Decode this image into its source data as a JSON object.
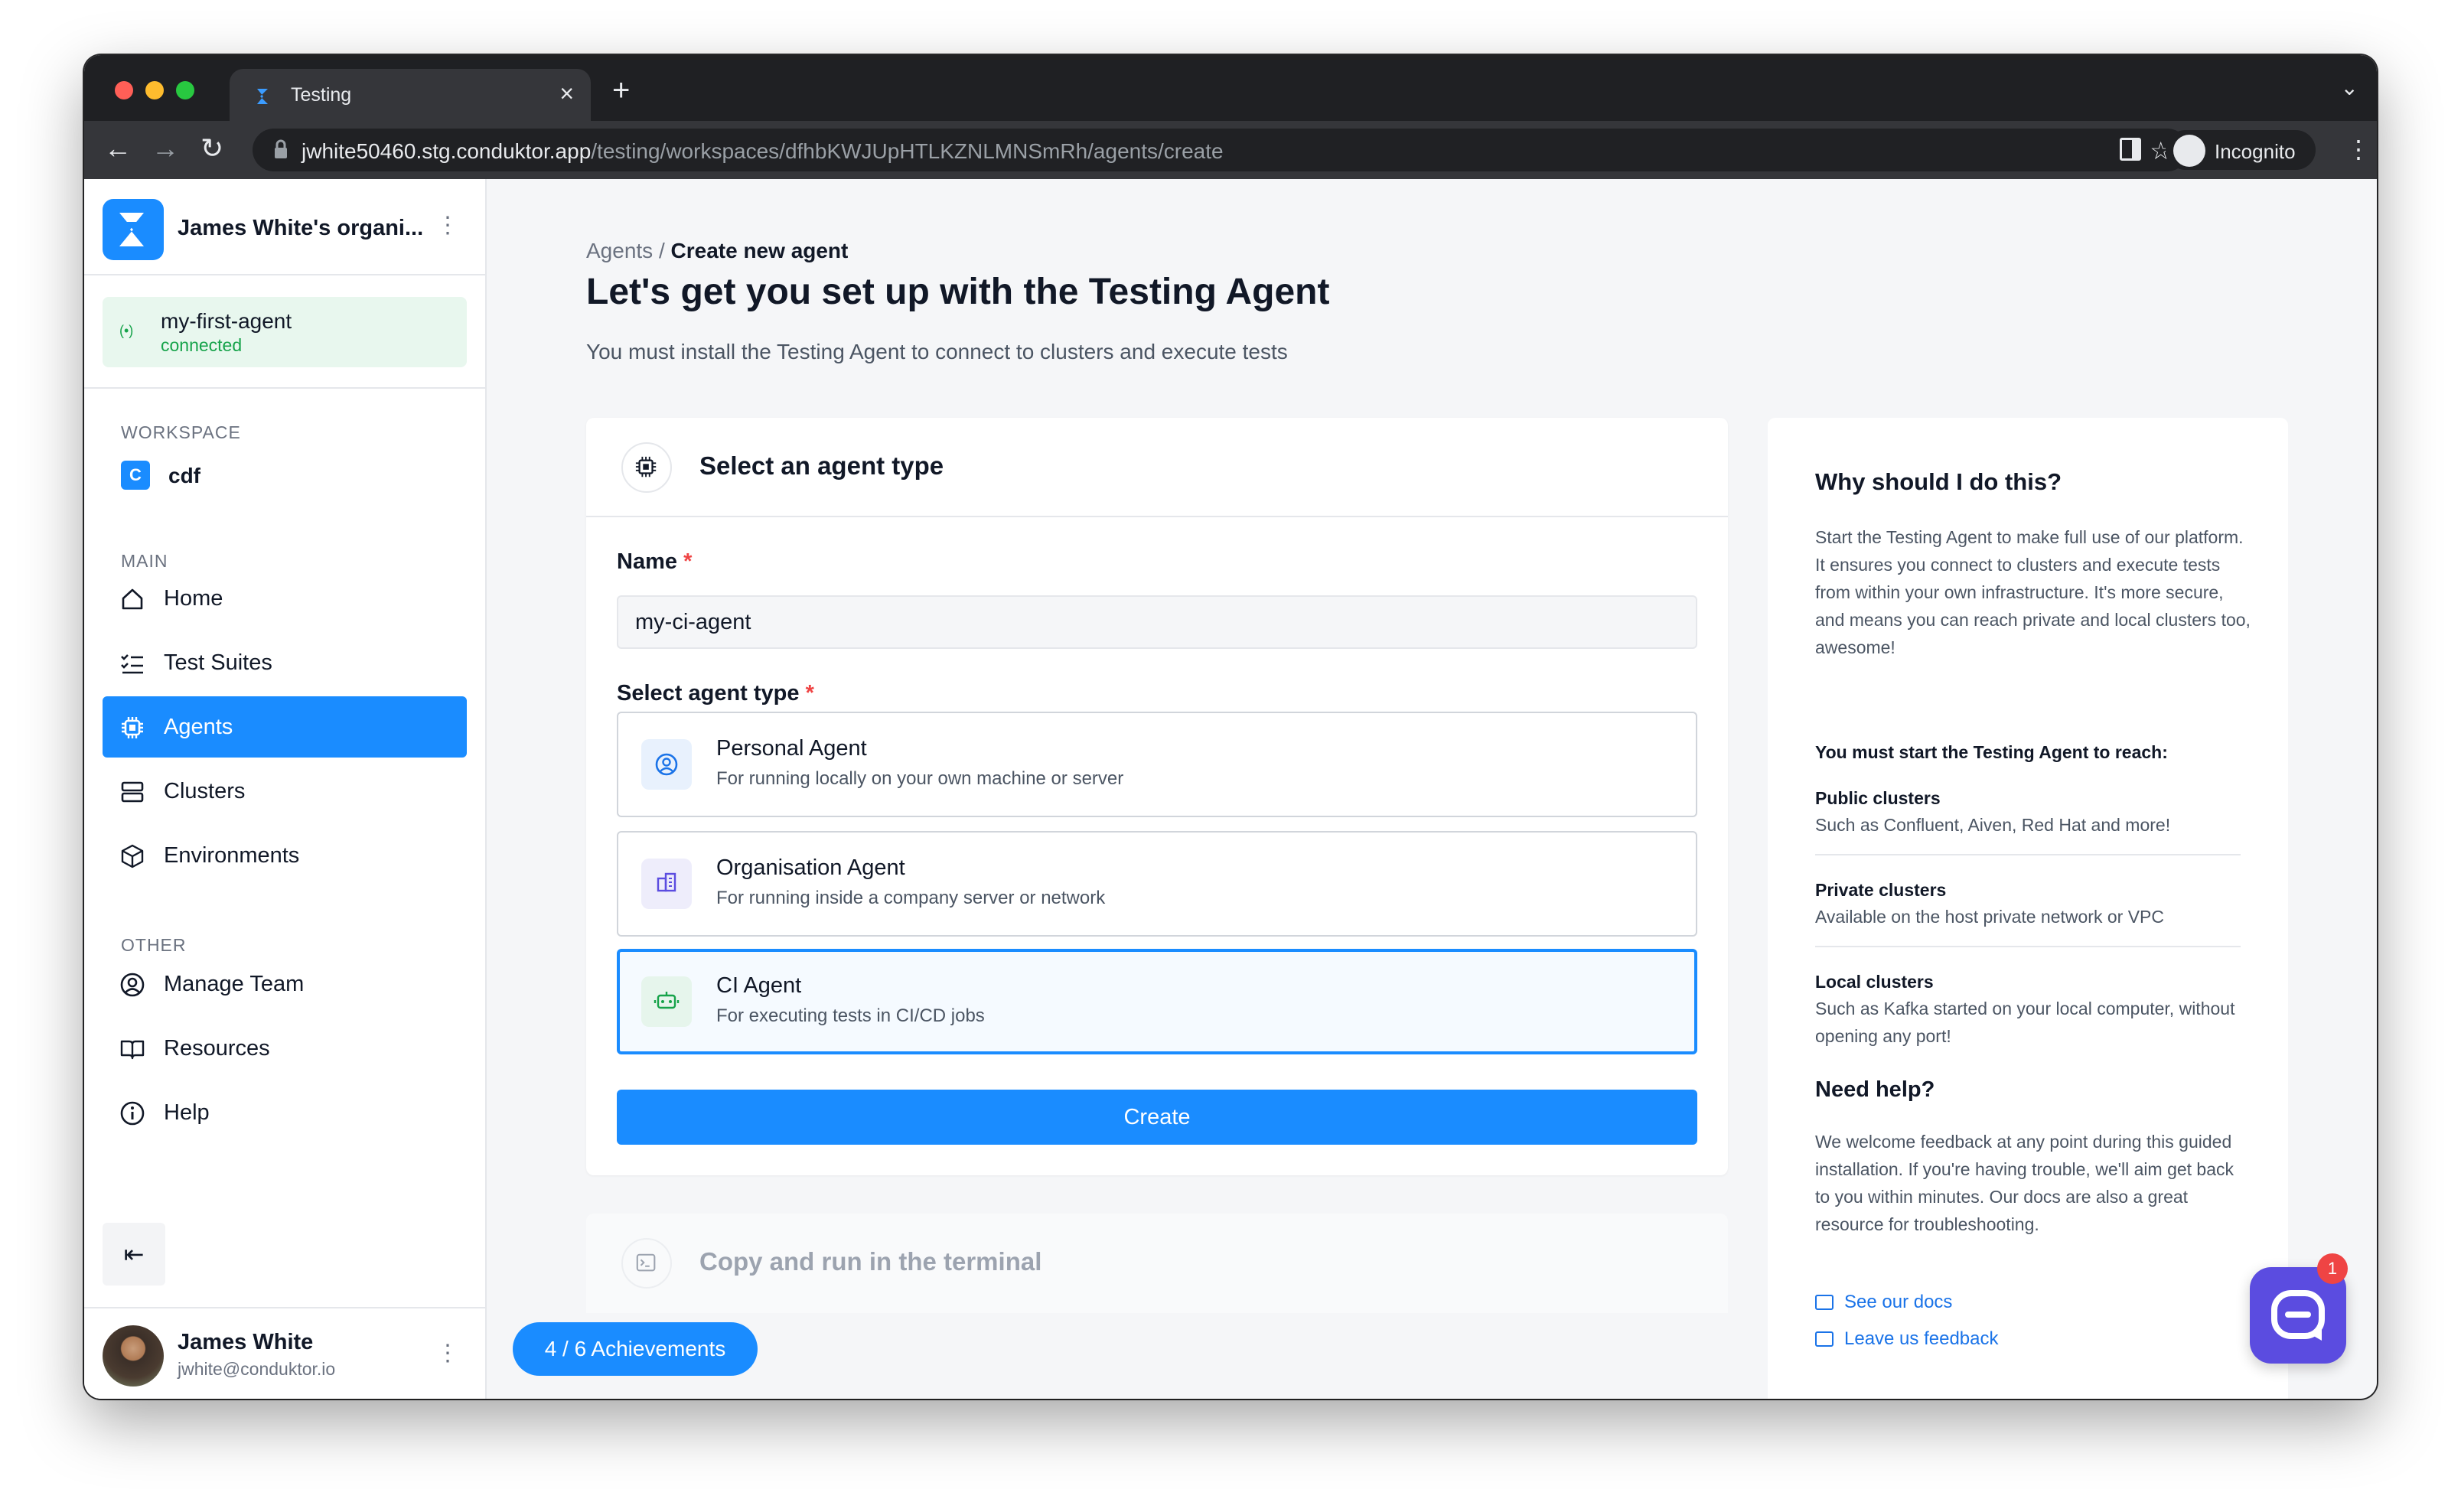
{
  "browser": {
    "tab_title": "Testing",
    "new_tab": "+",
    "url_host": "jwhite50460.stg.conduktor.app",
    "url_path": "/testing/workspaces/dfhbKWJUpHTLKZNLMNSmRh/agents/create",
    "profile_label": "Incognito"
  },
  "sidebar": {
    "org_name": "James White's organi...",
    "agent": {
      "name": "my-first-agent",
      "status": "connected"
    },
    "workspace_group": "WORKSPACE",
    "workspace": {
      "badge": "C",
      "name": "cdf"
    },
    "main_group": "MAIN",
    "main_items": [
      {
        "label": "Home",
        "icon": "home-icon"
      },
      {
        "label": "Test Suites",
        "icon": "checklist-icon"
      },
      {
        "label": "Agents",
        "icon": "chip-icon"
      },
      {
        "label": "Clusters",
        "icon": "server-icon"
      },
      {
        "label": "Environments",
        "icon": "cube-icon"
      }
    ],
    "other_group": "OTHER",
    "other_items": [
      {
        "label": "Manage Team",
        "icon": "user-circle-icon"
      },
      {
        "label": "Resources",
        "icon": "book-icon"
      },
      {
        "label": "Help",
        "icon": "info-icon"
      }
    ],
    "collapse_icon": "⇤",
    "user": {
      "name": "James White",
      "email": "jwhite@conduktor.io"
    }
  },
  "main": {
    "breadcrumb_parent": "Agents",
    "breadcrumb_sep": " / ",
    "breadcrumb_current": "Create new agent",
    "title": "Let's get you set up with the Testing Agent",
    "subtitle": "You must install the Testing Agent to connect to clusters and execute tests",
    "card_title": "Select an agent type",
    "name_label": "Name",
    "name_value": "my-ci-agent",
    "type_label": "Select agent type",
    "required_mark": "*",
    "options": [
      {
        "title": "Personal Agent",
        "desc": "For running locally on your own machine or server"
      },
      {
        "title": "Organisation Agent",
        "desc": "For running inside a company server or network"
      },
      {
        "title": "CI Agent",
        "desc": "For executing tests in CI/CD jobs"
      }
    ],
    "selected_option": "CI Agent",
    "create_label": "Create",
    "step2_title": "Copy and run in the terminal",
    "achievements": "4 / 6 Achievements"
  },
  "help_panel": {
    "title": "Why should I do this?",
    "body": "Start the Testing Agent to make full use of our platform. It ensures you connect to clusters and execute tests from within your own infrastructure. It's more secure, and means you can reach private and local clusters too, awesome!",
    "reach_title": "You must start the Testing Agent to reach:",
    "reach_items": [
      {
        "title": "Public clusters",
        "desc": "Such as Confluent, Aiven, Red Hat and more!"
      },
      {
        "title": "Private clusters",
        "desc": "Available on the host private network or VPC"
      },
      {
        "title": "Local clusters",
        "desc": "Such as Kafka started on your local computer, without opening any port!"
      }
    ],
    "help_title": "Need help?",
    "help_body": "We welcome feedback at any point during this guided installation. If you're having trouble, we'll aim get back to you within minutes. Our docs are also a great resource for troubleshooting.",
    "link_docs": "See our docs",
    "link_feedback": "Leave us feedback"
  },
  "chat": {
    "badge_count": "1"
  },
  "colors": {
    "accent": "#1a8cff",
    "success": "#16a34a",
    "required": "#ef4444",
    "chat": "#5b4ce0"
  }
}
